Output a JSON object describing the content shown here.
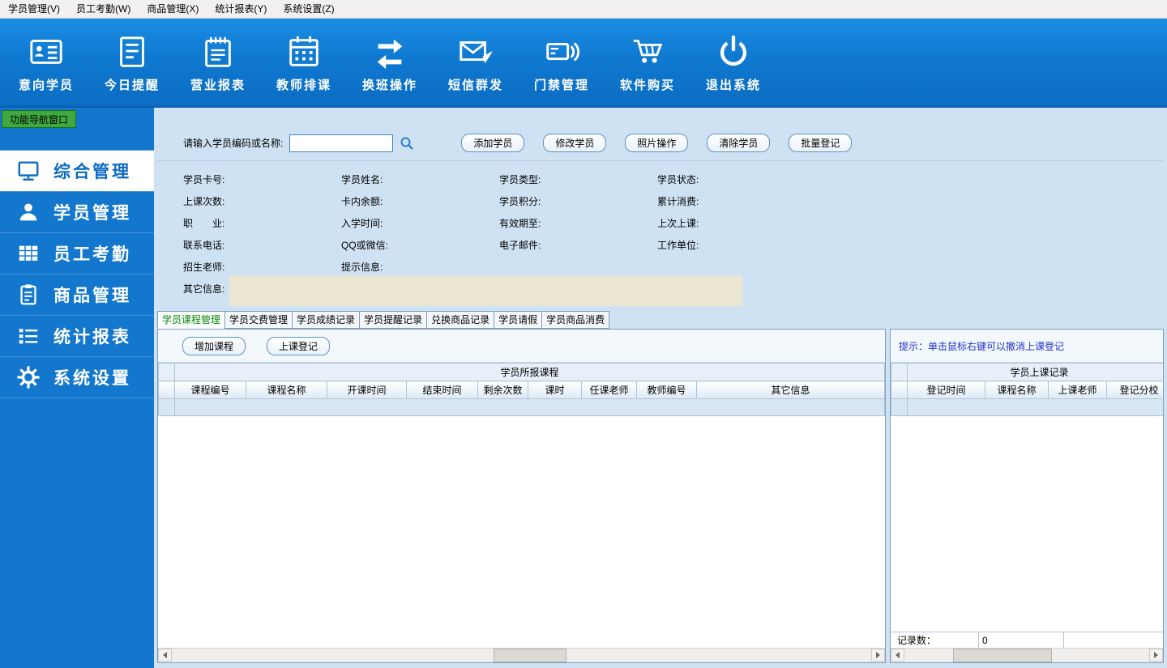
{
  "colors": {
    "toolbar_blue_top": "#1b8ce2",
    "toolbar_blue_bottom": "#0b6cc2",
    "sidebar_blue": "#1377cd",
    "nav_tab_green": "#3fa83f",
    "content_bg": "#cfe2f3",
    "beige_box": "#eae6d2",
    "hint_blue": "#2433cc",
    "tab_active_green": "#088a08"
  },
  "menu": {
    "items": [
      {
        "label": "学员管理(V)"
      },
      {
        "label": "员工考勤(W)"
      },
      {
        "label": "商品管理(X)"
      },
      {
        "label": "统计报表(Y)"
      },
      {
        "label": "系统设置(Z)"
      }
    ]
  },
  "toolbar": {
    "items": [
      {
        "label": "意向学员"
      },
      {
        "label": "今日提醒"
      },
      {
        "label": "营业报表"
      },
      {
        "label": "教师排课"
      },
      {
        "label": "换班操作"
      },
      {
        "label": "短信群发"
      },
      {
        "label": "门禁管理"
      },
      {
        "label": "软件购买"
      },
      {
        "label": "退出系统"
      }
    ]
  },
  "nav_tab": "功能导航窗口",
  "sidebar": {
    "items": [
      {
        "label": "综合管理",
        "active": true
      },
      {
        "label": "学员管理",
        "active": false
      },
      {
        "label": "员工考勤",
        "active": false
      },
      {
        "label": "商品管理",
        "active": false
      },
      {
        "label": "统计报表",
        "active": false
      },
      {
        "label": "系统设置",
        "active": false
      }
    ]
  },
  "search": {
    "label": "请输入学员编码或名称:",
    "value": ""
  },
  "actions": {
    "add": "添加学员",
    "modify": "修改学员",
    "photo": "照片操作",
    "clear": "清除学员",
    "batch": "批量登记"
  },
  "form": {
    "fields": [
      "学员卡号:",
      "学员姓名:",
      "学员类型:",
      "学员状态:",
      "上课次数:",
      "卡内余额:",
      "学员积分:",
      "累计消费:",
      "职　　业:",
      "入学时间:",
      "有效期至:",
      "上次上课:",
      "联系电话:",
      "QQ或微信:",
      "电子邮件:",
      "工作单位:",
      "招生老师:",
      "提示信息:"
    ],
    "other_info_label": "其它信息:"
  },
  "tabs": {
    "items": [
      {
        "label": "学员课程管理",
        "active": true
      },
      {
        "label": "学员交费管理",
        "active": false
      },
      {
        "label": "学员成绩记录",
        "active": false
      },
      {
        "label": "学员提醒记录",
        "active": false
      },
      {
        "label": "兑换商品记录",
        "active": false
      },
      {
        "label": "学员请假",
        "active": false
      },
      {
        "label": "学员商品消费",
        "active": false
      }
    ]
  },
  "course_panel": {
    "add_course": "增加课程",
    "register": "上课登记",
    "group_header": "学员所报课程",
    "columns": [
      "课程编号",
      "课程名称",
      "开课时间",
      "结束时间",
      "剩余次数",
      "课时",
      "任课老师",
      "教师编号",
      "其它信息"
    ]
  },
  "record_panel": {
    "hint": "提示：单击鼠标右键可以撤消上课登记",
    "group_header": "学员上课记录",
    "columns": [
      "登记时间",
      "课程名称",
      "上课老师",
      "登记分校"
    ],
    "record_count_label": "记录数：",
    "record_count": "0"
  }
}
